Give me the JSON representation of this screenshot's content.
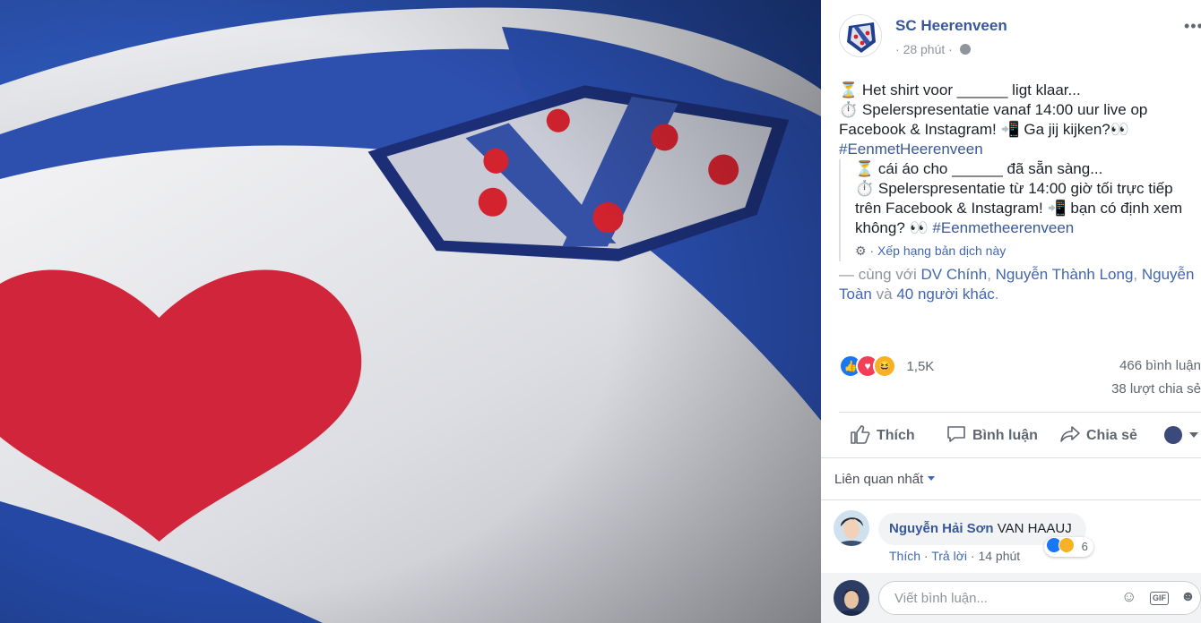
{
  "page": {
    "name": "SC Heerenveen",
    "time": "28 phút",
    "more_label": "•••",
    "globe_icon": "globe-icon"
  },
  "post": {
    "lines": [
      "⏳ Het shirt voor ______ ligt klaar...",
      "⏱️ Spelerspresentatie vanaf 14:00 uur live op",
      "Facebook & Instagram! 📲 Ga jij kijken?👀"
    ],
    "hashtag": "#EenmetHeerenveen"
  },
  "translation": {
    "lines": [
      "⏳ cái áo cho ______ đã sẵn sàng...",
      "⏱️ Spelerspresentatie từ 14:00 giờ tối trực tiếp",
      "trên Facebook & Instagram! 📲 bạn có định xem",
      "không? 👀"
    ],
    "hashtag": "#Eenmetheerenveen",
    "rate_label": "Xếp hạng bản dịch này",
    "gear_icon": "gear-icon"
  },
  "tagged": {
    "prefix": "— cùng với",
    "people": [
      "DV Chính",
      "Nguyễn Thành Long",
      "Nguyễn",
      "Toàn"
    ],
    "and_word": "và",
    "others": "40 người khác",
    "end": "."
  },
  "stats": {
    "reactions": "1,5K",
    "comments": "466 bình luận",
    "shares": "38 lượt chia sẻ"
  },
  "actions": {
    "like": "Thích",
    "comment": "Bình luận",
    "share": "Chia sẻ"
  },
  "sort": {
    "label": "Liên quan nhất"
  },
  "comment": {
    "author": "Nguyễn Hải Sơn",
    "text": "VAN HAAUJ",
    "reactions": "6",
    "like": "Thích",
    "reply": "Trả lời",
    "time": "14 phút"
  },
  "composer": {
    "placeholder": "Viết bình luận...",
    "gif_label": "GIF",
    "emoji_icon": "smile-icon",
    "sticker_icon": "sticker-icon"
  },
  "colors": {
    "link": "#385898",
    "muted": "#90949c",
    "shirt_blue": "#2b4fa8",
    "heart_red": "#d0253a"
  }
}
